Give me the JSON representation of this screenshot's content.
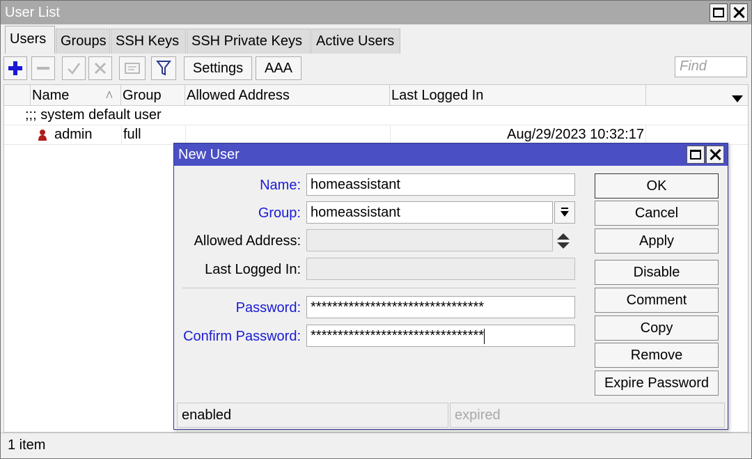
{
  "window": {
    "title": "User List"
  },
  "tabs": [
    {
      "label": "Users",
      "active": true
    },
    {
      "label": "Groups"
    },
    {
      "label": "SSH Keys"
    },
    {
      "label": "SSH Private Keys"
    },
    {
      "label": "Active Users"
    }
  ],
  "toolbar": {
    "settings_label": "Settings",
    "aaa_label": "AAA",
    "find_placeholder": "Find",
    "icons": [
      "plus-icon",
      "minus-icon",
      "check-icon",
      "cross-icon",
      "comment-icon",
      "filter-icon"
    ]
  },
  "table": {
    "columns": [
      "Name",
      "Group",
      "Allowed Address",
      "Last Logged In"
    ],
    "comment_row": ";;; system default user",
    "rows": [
      {
        "name": "admin",
        "group": "full",
        "allowed_address": "",
        "last_logged_in": "Aug/29/2023 10:32:17"
      }
    ]
  },
  "status": {
    "count": "1 item"
  },
  "dialog": {
    "title": "New User",
    "fields": {
      "name": {
        "label": "Name:",
        "value": "homeassistant"
      },
      "group": {
        "label": "Group:",
        "value": "homeassistant"
      },
      "allowed_address": {
        "label": "Allowed Address:",
        "value": ""
      },
      "last_logged_in": {
        "label": "Last Logged In:",
        "value": ""
      },
      "password": {
        "label": "Password:",
        "value": "********************************"
      },
      "confirm_password": {
        "label": "Confirm Password:",
        "value": "********************************"
      }
    },
    "buttons": {
      "ok": "OK",
      "cancel": "Cancel",
      "apply": "Apply",
      "disable": "Disable",
      "comment": "Comment",
      "copy": "Copy",
      "remove": "Remove",
      "expire_password": "Expire Password"
    },
    "status": {
      "left": "enabled",
      "right": "expired"
    }
  },
  "colors": {
    "required_label": "#1a1ad6",
    "dialog_title_bg": "#4a4fc4",
    "window_title_bg": "#a9a9a9",
    "user_icon": "#b01c1c"
  }
}
